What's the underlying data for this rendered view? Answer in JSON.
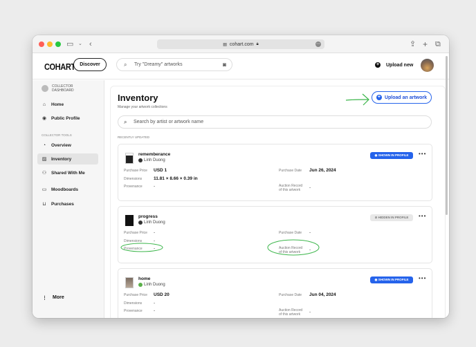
{
  "browser": {
    "url": "cohart.com"
  },
  "topnav": {
    "logo": "COHART",
    "discover_label": "Discover",
    "search_placeholder": "Try \"Dreamy\" artworks",
    "upload_label": "Upload new"
  },
  "sidebar": {
    "header": "COLLECTOR DASHBOARD",
    "items_top": [
      {
        "label": "Home",
        "icon": "home-icon"
      },
      {
        "label": "Public Profile",
        "icon": "profile-icon"
      }
    ],
    "section_label": "COLLECTOR TOOLS",
    "items_tools": [
      {
        "label": "Overview",
        "icon": "overview-icon"
      },
      {
        "label": "Inventory",
        "icon": "image-icon",
        "active": true
      },
      {
        "label": "Shared With Me",
        "icon": "people-icon"
      },
      {
        "label": "Moodboards",
        "icon": "folder-icon"
      },
      {
        "label": "Purchases",
        "icon": "bag-icon"
      }
    ],
    "more_label": "More"
  },
  "main": {
    "title": "Inventory",
    "subtitle": "Manage your artwork collections",
    "upload_button": "Upload an artwork",
    "search_placeholder": "Search by artist or artwork name",
    "recent_label": "RECENTLY UPDATED"
  },
  "labels": {
    "purchase_price": "Purchase Price",
    "dimensions": "Dimensions",
    "provenance": "Provenance",
    "purchase_date": "Purchase Date",
    "auction_record_1": "Auction Record",
    "auction_record_2": "of this artwork"
  },
  "artworks": [
    {
      "title": "rememberance",
      "artist": "Linh Duong",
      "badge": "SHOWN IN PROFILE",
      "purchase_price": "USD 1",
      "dimensions": "11.81 × 8.66 × 0.39 in",
      "provenance": "-",
      "purchase_date": "Jun 26, 2024",
      "auction_record": "-"
    },
    {
      "title": "progress",
      "artist": "Linh Duong",
      "badge": "HIDDEN IN PROFILE",
      "purchase_price": "-",
      "dimensions": "-",
      "provenance": "-",
      "purchase_date": "-",
      "auction_record": "-"
    },
    {
      "title": "home",
      "artist": "Linh Duong",
      "badge": "SHOWN IN PROFILE",
      "purchase_price": "USD 20",
      "dimensions": "-",
      "provenance": "-",
      "purchase_date": "Jun 04, 2024",
      "auction_record": "-"
    }
  ],
  "colors": {
    "accent": "#2563eb",
    "annotation": "#3bb54a"
  }
}
